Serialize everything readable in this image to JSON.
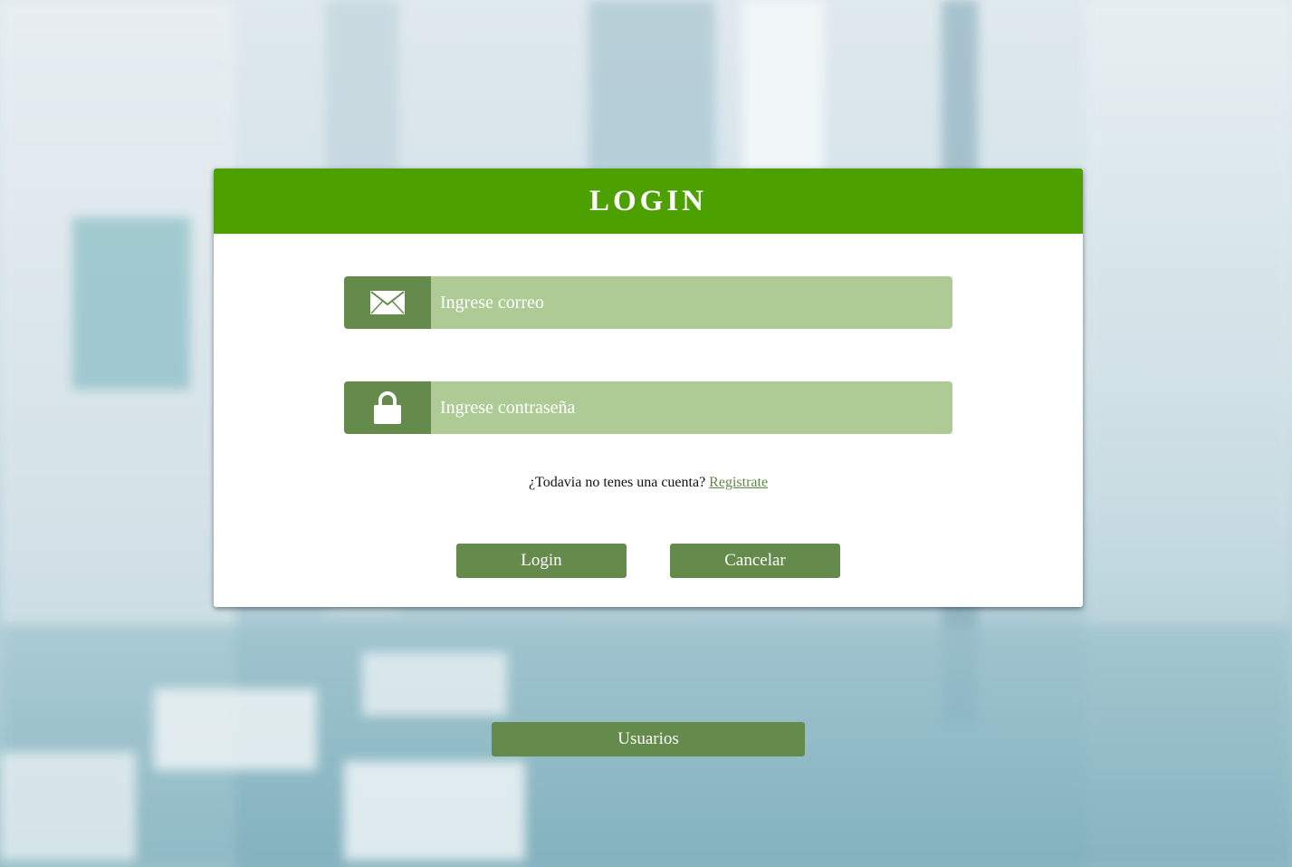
{
  "login_card": {
    "title": "LOGIN",
    "email_field": {
      "placeholder": "Ingrese correo",
      "value": "",
      "icon": "envelope-icon"
    },
    "password_field": {
      "placeholder": "Ingrese contraseña",
      "value": "",
      "icon": "lock-icon"
    },
    "signup_prompt": "¿Todavia no tenes una cuenta?",
    "signup_link": "Registrate",
    "login_button": "Login",
    "cancel_button": "Cancelar"
  },
  "users_button": "Usuarios",
  "colors": {
    "header_green": "#4ca000",
    "button_green": "#648a4c",
    "field_green": "#aecb95",
    "link_green": "#5f8746"
  }
}
